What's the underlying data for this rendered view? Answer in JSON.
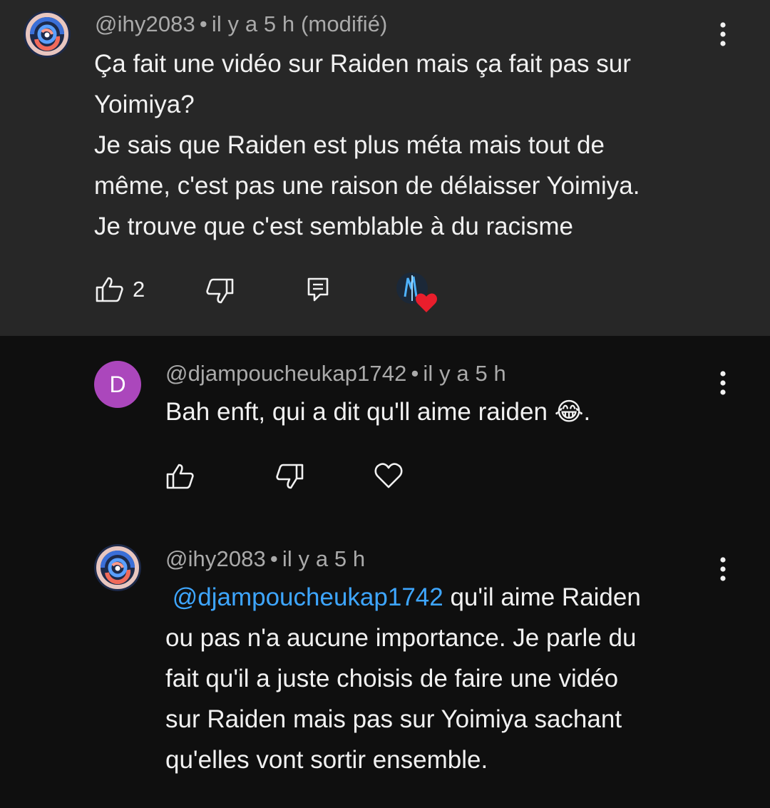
{
  "comments": [
    {
      "author": "@ihy2083",
      "separator": "•",
      "time": "il y a 5 h (modifié)",
      "text": "Ça fait une vidéo sur Raiden mais ça fait pas sur\nYoimiya?\nJe sais que Raiden est plus méta mais tout de\nmême, c'est pas une raison de délaisser Yoimiya.\nJe trouve que c'est semblable à du racisme",
      "like_count": "2",
      "icons": {
        "like": "thumb-up-icon",
        "dislike": "thumb-down-icon",
        "reply": "reply-icon",
        "more": "more-vertical-icon",
        "creator_heart": "creator-heart-icon"
      }
    },
    {
      "author": "@djampoucheukap1742",
      "separator": "•",
      "time": "il y a 5 h",
      "avatar_letter": "D",
      "text_before_emoji": "Bah enft, qui a dit qu'll aime raiden ",
      "emoji": "😂",
      "text_after_emoji": ".",
      "icons": {
        "like": "thumb-up-icon",
        "dislike": "thumb-down-icon",
        "heart": "heart-outline-icon",
        "more": "more-vertical-icon"
      }
    },
    {
      "author": "@ihy2083",
      "separator": "•",
      "time": "il y a 5 h",
      "mention": "@djampoucheukap1742",
      "text_line1_rest": " qu'il aime Raiden",
      "text_rest": "ou pas n'a aucune importance. Je parle du\nfait qu'il a juste choisis de faire une vidéo\nsur Raiden mais pas sur Yoimiya sachant\nqu'elles vont sortir ensemble.",
      "icons": {
        "more": "more-vertical-icon"
      }
    }
  ],
  "colors": {
    "highlight_bg": "#272727",
    "page_bg": "#0f0f0f",
    "mention": "#3ea6ff",
    "avatar_purple": "#ab47bc",
    "heart_red": "#e91e2c"
  }
}
